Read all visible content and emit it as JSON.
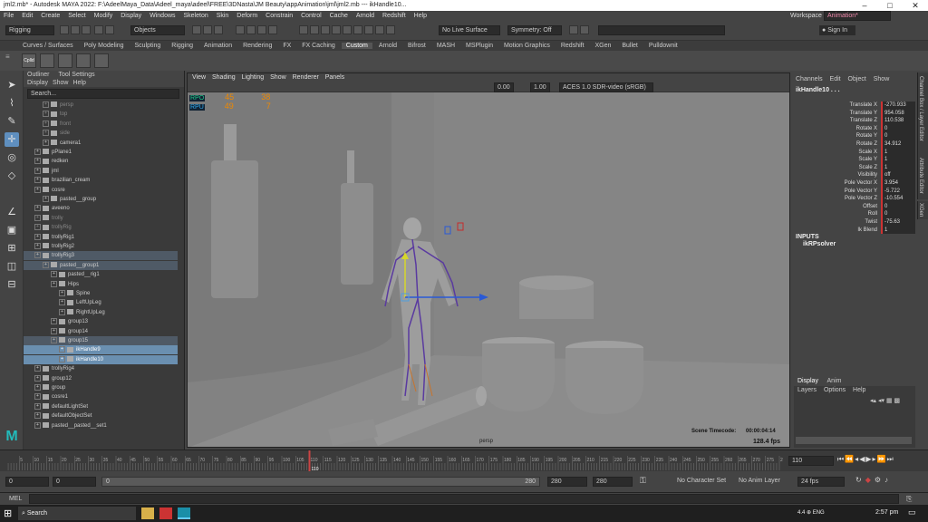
{
  "window": {
    "title": "jml2.mb* - Autodesk MAYA 2022: F:\\AdeelMaya_Data\\Adeel_maya\\adeel\\FREE\\3DNasta\\JM Beauty\\appAnimation\\jml\\jml2.mb   ---   ikHandle10...",
    "app_icon": "maya-icon"
  },
  "menubar": {
    "items": [
      "File",
      "Edit",
      "Create",
      "Select",
      "Modify",
      "Display",
      "Windows",
      "Skeleton",
      "Skin",
      "Deform",
      "Constrain",
      "Control",
      "Cache",
      "Arnold",
      "Redshift",
      "Help"
    ],
    "workspace_label": "Workspace :",
    "workspace_value": "Animation*"
  },
  "statusline": {
    "menuset": "Rigging",
    "select_mode": "Objects",
    "live_surface": "No Live Surface",
    "symmetry": "Symmetry: Off",
    "sign_in": "Sign In"
  },
  "shelf": {
    "tabs": [
      "Curves / Surfaces",
      "Poly Modeling",
      "Sculpting",
      "Rigging",
      "Animation",
      "Rendering",
      "FX",
      "FX Caching",
      "Custom",
      "Arnold",
      "Bifrost",
      "MASH",
      "MSPlugin",
      "Motion Graphics",
      "Redshift",
      "XGen",
      "Bullet",
      "Pulldownit"
    ],
    "active_tab": "Custom",
    "first_icon_label": "Cplld"
  },
  "outliner": {
    "title": "Outliner",
    "tool_settings": "Tool Settings",
    "menu": [
      "Display",
      "Show",
      "Help"
    ],
    "search_placeholder": "Search...",
    "rows": [
      {
        "label": "persp",
        "indent": 1,
        "dim": true
      },
      {
        "label": "top",
        "indent": 1,
        "dim": true
      },
      {
        "label": "front",
        "indent": 1,
        "dim": true
      },
      {
        "label": "side",
        "indent": 1,
        "dim": true
      },
      {
        "label": "camera1",
        "indent": 1
      },
      {
        "label": "pPlane1",
        "indent": 0
      },
      {
        "label": "redken",
        "indent": 0
      },
      {
        "label": "jml",
        "indent": 0
      },
      {
        "label": "brazilian_cream",
        "indent": 0
      },
      {
        "label": "cosre",
        "indent": 0
      },
      {
        "label": "pasted__group",
        "indent": 1
      },
      {
        "label": "aveeno",
        "indent": 0
      },
      {
        "label": "trolly",
        "indent": 0,
        "dim": true
      },
      {
        "label": "trollyRig",
        "indent": 0,
        "dim": true
      },
      {
        "label": "trollyRig1",
        "indent": 0
      },
      {
        "label": "trollyRig2",
        "indent": 0
      },
      {
        "label": "trollyRig3",
        "indent": 0,
        "hl": true
      },
      {
        "label": "pasted__group1",
        "indent": 1,
        "hl": true
      },
      {
        "label": "pasted__rig1",
        "indent": 2
      },
      {
        "label": "Hips",
        "indent": 2
      },
      {
        "label": "Spine",
        "indent": 3
      },
      {
        "label": "LeftUpLeg",
        "indent": 3
      },
      {
        "label": "RightUpLeg",
        "indent": 3
      },
      {
        "label": "group13",
        "indent": 2
      },
      {
        "label": "group14",
        "indent": 2
      },
      {
        "label": "group15",
        "indent": 2,
        "hl": true
      },
      {
        "label": "ikHandle9",
        "indent": 3,
        "sel": true
      },
      {
        "label": "ikHandle10",
        "indent": 3,
        "sel": true
      },
      {
        "label": "trollyRig4",
        "indent": 0
      },
      {
        "label": "group12",
        "indent": 0
      },
      {
        "label": "group",
        "indent": 0
      },
      {
        "label": "cosre1",
        "indent": 0
      },
      {
        "label": "defaultLightSet",
        "indent": 0
      },
      {
        "label": "defaultObjectSet",
        "indent": 0
      },
      {
        "label": "pasted__pasted__set1",
        "indent": 0
      }
    ]
  },
  "viewport": {
    "menu": [
      "View",
      "Shading",
      "Lighting",
      "Show",
      "Renderer",
      "Panels"
    ],
    "exposure": "0.00",
    "gamma": "1.00",
    "colorspace": "ACES 1.0 SDR-video (sRGB)",
    "hud": {
      "fps_label1": "RPO",
      "v1a": "45",
      "v1b": "38",
      "fps_label2": "RPU",
      "v2a": "49",
      "v2b": "7"
    },
    "camera_label": "persp",
    "timecode_label": "Scene Timecode:",
    "timecode_value": "00:00:04:14",
    "fps": "128.4 fps"
  },
  "channelbox": {
    "menu": [
      "Channels",
      "Edit",
      "Object",
      "Show"
    ],
    "object_name": "ikHandle10 . . .",
    "channels": [
      {
        "name": "Translate X",
        "value": "-270.933"
      },
      {
        "name": "Translate Y",
        "value": "954.058"
      },
      {
        "name": "Translate Z",
        "value": "110.538"
      },
      {
        "name": "Rotate X",
        "value": "0"
      },
      {
        "name": "Rotate Y",
        "value": "0"
      },
      {
        "name": "Rotate Z",
        "value": "34.912"
      },
      {
        "name": "Scale X",
        "value": "1"
      },
      {
        "name": "Scale Y",
        "value": "1"
      },
      {
        "name": "Scale Z",
        "value": "1"
      },
      {
        "name": "Visibility",
        "value": "off"
      },
      {
        "name": "Pole Vector X",
        "value": "3.954"
      },
      {
        "name": "Pole Vector Y",
        "value": "-5.722"
      },
      {
        "name": "Pole Vector Z",
        "value": "-10.554"
      },
      {
        "name": "Offset",
        "value": "0"
      },
      {
        "name": "Roll",
        "value": "0"
      },
      {
        "name": "Twist",
        "value": "-75.63"
      },
      {
        "name": "Ik Blend",
        "value": "1"
      }
    ],
    "inputs_label": "INPUTS",
    "input_node": "ikRPsolver"
  },
  "side_tabs": {
    "channel_box": "Channel Box / Layer Editor",
    "attribute_editor": "Attribute Editor",
    "xgen": "XGen"
  },
  "layer_editor": {
    "tabs": [
      "Display",
      "Anim"
    ],
    "menu": [
      "Layers",
      "Options",
      "Help"
    ]
  },
  "timeline": {
    "ticks": [
      "5",
      "10",
      "15",
      "20",
      "25",
      "30",
      "35",
      "40",
      "45",
      "50",
      "55",
      "60",
      "65",
      "70",
      "75",
      "80",
      "85",
      "90",
      "95",
      "100",
      "105",
      "110",
      "115",
      "120",
      "125",
      "130",
      "135",
      "140",
      "145",
      "150",
      "155",
      "160",
      "165",
      "170",
      "175",
      "180",
      "185",
      "190",
      "195",
      "200",
      "205",
      "210",
      "215",
      "220",
      "225",
      "230",
      "235",
      "240",
      "245",
      "250",
      "255",
      "260",
      "265",
      "270",
      "275",
      "280"
    ],
    "current_frame": "110",
    "frame_field": "110"
  },
  "range": {
    "start": "0",
    "start_inner": "0",
    "range_start": "0",
    "range_end": "280",
    "end_inner": "280",
    "end": "280",
    "character_set": "No Character Set",
    "anim_layer": "No Anim Layer",
    "fps": "24 fps"
  },
  "mel": {
    "label": "MEL"
  },
  "taskbar": {
    "search": "Search",
    "time": "2:57 pm",
    "lang": "ENG",
    "tray": "4.4  ⊕  ENG"
  }
}
